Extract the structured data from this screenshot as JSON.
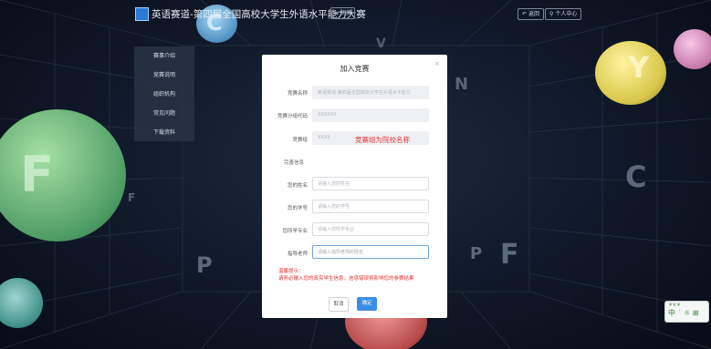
{
  "header": {
    "title": "英语赛道-第四届全国高校大学生外语水平能力大赛",
    "switch_label": "⇆ 切换",
    "back_label": "返回",
    "user_label": "个人中心"
  },
  "sidebar": {
    "items": [
      {
        "label": "赛事介绍"
      },
      {
        "label": "竞赛说明"
      },
      {
        "label": "组织机构"
      },
      {
        "label": "常见问题"
      },
      {
        "label": "下载资料"
      }
    ]
  },
  "dialog": {
    "title": "加入竞赛",
    "close": "×",
    "fields": {
      "competition_name": {
        "label": "竞赛名称",
        "value": "英语赛道-第四届全国高校大学生外语水平能力"
      },
      "group_code": {
        "label": "竞赛分组代码",
        "value": "XXXXXX"
      },
      "group": {
        "label": "竞赛组",
        "value": "XXXX",
        "annotation": "竞赛组为院校名称"
      },
      "section_title": "完善信息",
      "name": {
        "label": "您的姓名",
        "placeholder": "请输入您的姓名"
      },
      "student_id": {
        "label": "您的学号",
        "placeholder": "请输入您的学号"
      },
      "major": {
        "label": "您所学专业",
        "placeholder": "请输入您所学专业"
      },
      "teacher": {
        "label": "指导老师",
        "placeholder": "请输入指导老师的姓名"
      }
    },
    "tip_title": "温馨提示：",
    "tip_body": "请务必输入您的真实学生信息，信息错误将影响您的参赛结果",
    "cancel": "取消",
    "confirm": "确定"
  },
  "widget": {
    "top": "Ψ Ψ Ψ",
    "main": "中 ˙ ☼ ⊞"
  },
  "decor": {
    "letters": [
      "C",
      "F",
      "Y",
      "C",
      "F",
      "P",
      "P",
      "N",
      "F",
      "V"
    ]
  },
  "colors": {
    "accent": "#3a8ee6",
    "warning": "#e03131"
  }
}
